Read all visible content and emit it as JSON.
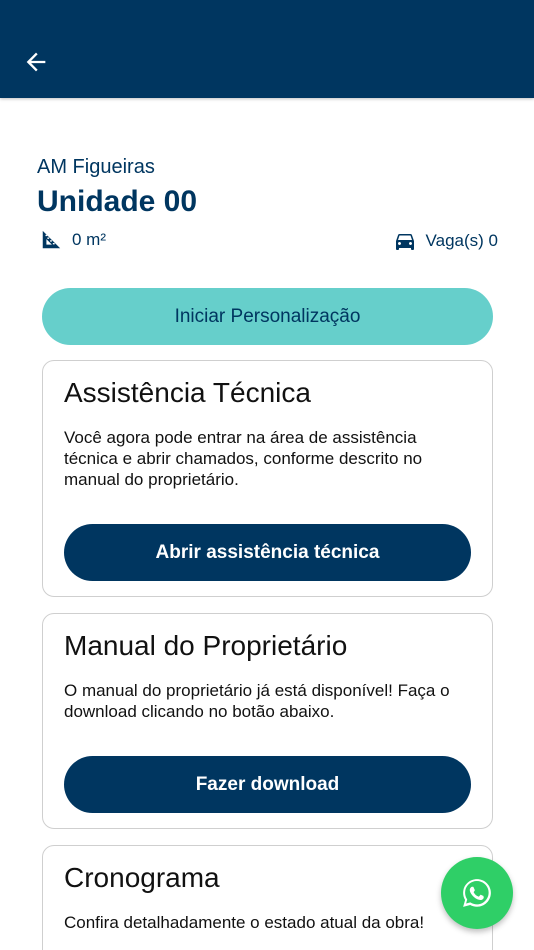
{
  "header": {
    "back_icon": "arrow-left-icon"
  },
  "property": {
    "project_name": "AM Figueiras",
    "unit_name": "Unidade 00",
    "area_icon": "set-square-icon",
    "area": "0 m²",
    "parking_icon": "car-icon",
    "parking": "Vaga(s) 0"
  },
  "personalize_button": "Iniciar Personalização",
  "cards": {
    "assistance": {
      "title": "Assistência Técnica",
      "text": "Você agora pode entrar na área de assistência técnica e abrir chamados, conforme descrito no manual do proprietário.",
      "button": "Abrir assistência técnica"
    },
    "manual": {
      "title": "Manual do Proprietário",
      "text": "O manual do proprietário já está disponível! Faça o download clicando no botão abaixo.",
      "button": "Fazer download"
    },
    "schedule": {
      "title": "Cronograma",
      "text": "Confira detalhadamente o estado atual da obra!"
    }
  },
  "fab": {
    "icon": "whatsapp-icon"
  },
  "colors": {
    "primary": "#003660",
    "accent": "#66cfcb",
    "whatsapp": "#2fcf67"
  }
}
